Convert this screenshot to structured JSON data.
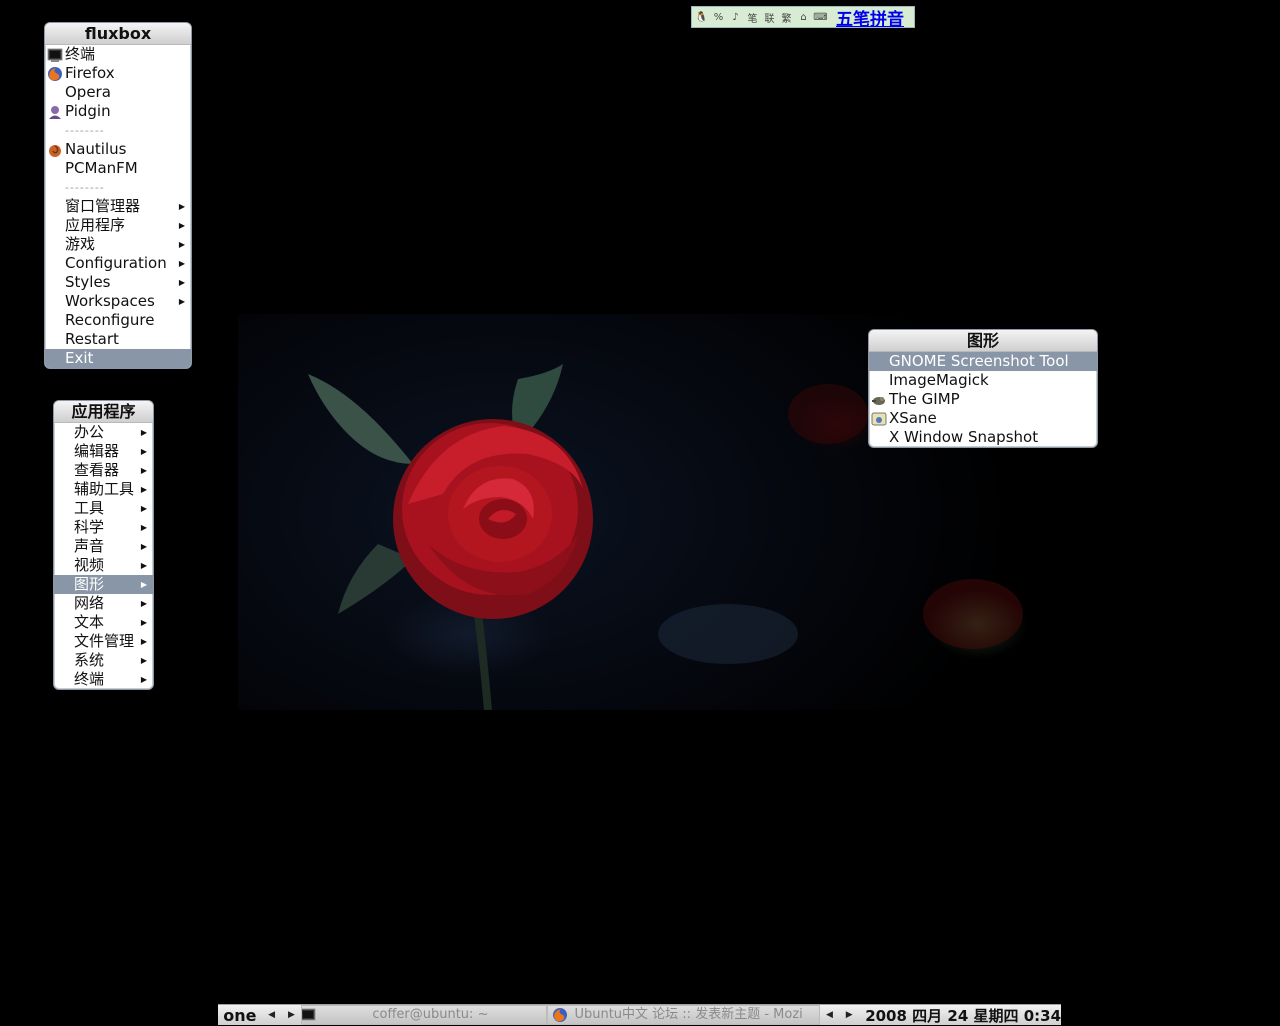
{
  "ime": {
    "buttons": [
      "🐧",
      "%",
      "♪",
      "笔",
      "联",
      "繁",
      "⌂",
      "⌨"
    ],
    "mode_label": "五笔拼音"
  },
  "fluxbox_menu": {
    "title": "fluxbox",
    "items": [
      {
        "label": "终端",
        "icon": "terminal-icon"
      },
      {
        "label": "Firefox",
        "icon": "firefox-icon"
      },
      {
        "label": "Opera",
        "icon": ""
      },
      {
        "label": "Pidgin",
        "icon": "pidgin-icon"
      },
      {
        "separator": "--------"
      },
      {
        "label": "Nautilus",
        "icon": "nautilus-icon"
      },
      {
        "label": "PCManFM",
        "icon": ""
      },
      {
        "separator": "--------"
      },
      {
        "label": "窗口管理器",
        "submenu": true
      },
      {
        "label": "应用程序",
        "submenu": true
      },
      {
        "label": "游戏",
        "submenu": true
      },
      {
        "label": "Configuration",
        "submenu": true
      },
      {
        "label": "Styles",
        "submenu": true
      },
      {
        "label": "Workspaces",
        "submenu": true
      },
      {
        "label": "Reconfigure"
      },
      {
        "label": "Restart"
      },
      {
        "label": "Exit",
        "active": true
      }
    ]
  },
  "apps_menu": {
    "title": "应用程序",
    "items": [
      "办公",
      "编辑器",
      "查看器",
      "辅助工具",
      "工具",
      "科学",
      "声音",
      "视频",
      "图形",
      "网络",
      "文本",
      "文件管理",
      "系统",
      "终端"
    ],
    "active_index": 8
  },
  "graphics_menu": {
    "title": "图形",
    "items": [
      {
        "label": "GNOME Screenshot Tool",
        "active": true
      },
      {
        "label": "ImageMagick"
      },
      {
        "label": "The GIMP",
        "icon": "gimp-icon"
      },
      {
        "label": "XSane",
        "icon": "xsane-icon"
      },
      {
        "label": "X Window Snapshot"
      }
    ]
  },
  "toolbar": {
    "workspace": "one",
    "tasks": [
      {
        "label": "coffer@ubuntu: ~",
        "icon": "terminal-icon"
      },
      {
        "label": "Ubuntu中文 论坛 :: 发表新主题 - Mozi",
        "icon": "firefox-icon"
      }
    ],
    "clock": "2008 四月 24 星期四  0:34"
  },
  "colors": {
    "menu_highlight": "#8896a8",
    "ime_link": "#0000ee",
    "desktop_bg": "#000000"
  }
}
